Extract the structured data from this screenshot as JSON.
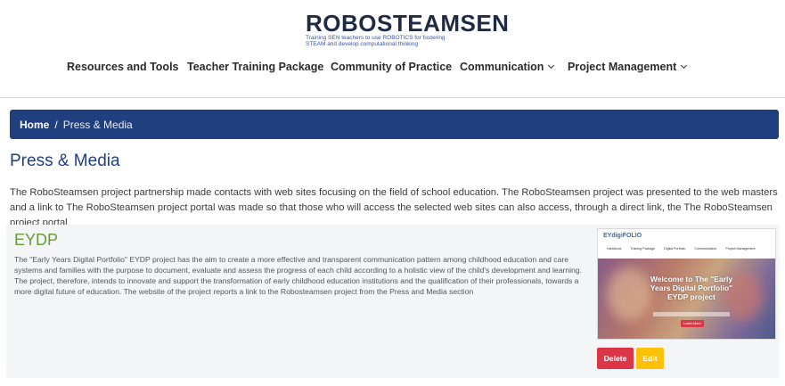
{
  "logo": {
    "title": "ROBOSTEAMSEN",
    "tagline": "Training SEN teachers to use ROBOTICS for fostering STEAM and develop computational thinking"
  },
  "nav": {
    "items": [
      {
        "label": "Resources and Tools",
        "has_dropdown": false
      },
      {
        "label": "Teacher Training Package",
        "has_dropdown": false
      },
      {
        "label": "Community of Practice",
        "has_dropdown": false
      },
      {
        "label": "Communication",
        "has_dropdown": true
      },
      {
        "label": "Project Management",
        "has_dropdown": true
      }
    ]
  },
  "breadcrumb": {
    "home": "Home",
    "separator": "/",
    "current": "Press & Media"
  },
  "page": {
    "title": "Press & Media",
    "intro": "The RoboSteamsen project partnership made contacts with web sites focusing on the field of school education. The RoboSteamsen project was presented to the web masters and a link to The RoboSteamsen project portal was made so that those who will access the selected web sites can also access, through a direct link, the The RoboSteamsen project portal."
  },
  "card": {
    "title": "EYDP",
    "description": "The \"Early Years Digital Portfolio\" EYDP project has the aim to create a more effective and transparent communication pattern among childhood education and care systems and families with the purpose to document, evaluate and assess the progress of each child according to a holistic view of the child's development and learning. The project, therefore, intends to innovate and support the transformation of early childhood education institutions and the qualification of their professionals, towards a more digital future of education. The website of the project reports a link to the Robosteamsen project from the Press and Media section",
    "thumbnail": {
      "logo": "EYdigiFOLIO",
      "menu": [
        "Handbook",
        "Training Package",
        "Digital Portfolio",
        "Communication",
        "Project Management"
      ],
      "welcome": "Welcome to The \"Early Years Digital Portfolio\" EYDP project",
      "button": "Learn More"
    },
    "delete_label": "Delete",
    "edit_label": "Edit"
  },
  "colors": {
    "brand_blue": "#1f3f7f",
    "title_green": "#6a9a3a",
    "delete_red": "#dc3545",
    "edit_yellow": "#ffc107"
  }
}
